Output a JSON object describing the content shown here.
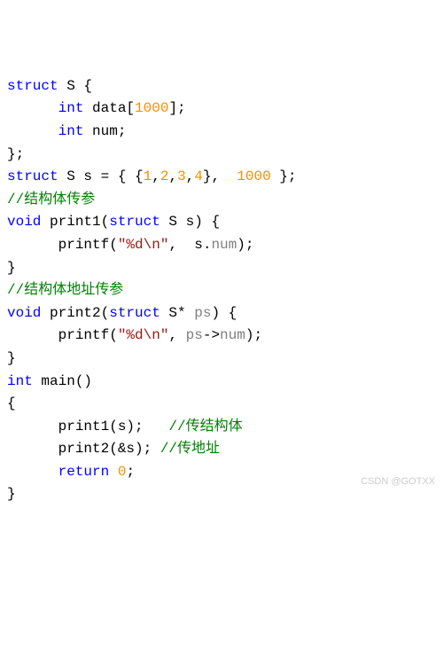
{
  "lines": [
    {
      "indent": 0,
      "parts": [
        {
          "c": "kw",
          "t": "struct"
        },
        {
          "t": " S {"
        }
      ]
    },
    {
      "indent": 1,
      "parts": [
        {
          "c": "kw",
          "t": "int"
        },
        {
          "t": " data["
        },
        {
          "c": "num",
          "t": "1000"
        },
        {
          "t": "];"
        }
      ]
    },
    {
      "indent": 1,
      "parts": [
        {
          "c": "kw",
          "t": "int"
        },
        {
          "t": " num;"
        }
      ]
    },
    {
      "indent": 0,
      "parts": [
        {
          "t": "};"
        }
      ]
    },
    {
      "indent": 0,
      "parts": [
        {
          "c": "kw",
          "t": "struct"
        },
        {
          "t": " S s = { {"
        },
        {
          "c": "num",
          "t": "1"
        },
        {
          "t": ","
        },
        {
          "c": "num",
          "t": "2"
        },
        {
          "t": ","
        },
        {
          "c": "num",
          "t": "3"
        },
        {
          "t": ","
        },
        {
          "c": "num",
          "t": "4"
        },
        {
          "t": "},  "
        },
        {
          "c": "num",
          "t": "1000"
        },
        {
          "t": " };"
        }
      ]
    },
    {
      "indent": 0,
      "parts": [
        {
          "c": "comment",
          "t": "//结构体传参"
        }
      ]
    },
    {
      "indent": 0,
      "parts": [
        {
          "c": "kw",
          "t": "void"
        },
        {
          "t": " print1("
        },
        {
          "c": "kw",
          "t": "struct"
        },
        {
          "t": " S s) {"
        }
      ]
    },
    {
      "indent": 1,
      "parts": [
        {
          "t": "printf("
        },
        {
          "c": "str",
          "t": "\"%d\\n\""
        },
        {
          "t": ",  s."
        },
        {
          "c": "member",
          "t": "num"
        },
        {
          "t": ");"
        }
      ]
    },
    {
      "indent": 0,
      "parts": [
        {
          "t": "}"
        }
      ]
    },
    {
      "indent": 0,
      "parts": [
        {
          "c": "comment",
          "t": "//结构体地址传参"
        }
      ]
    },
    {
      "indent": 0,
      "parts": [
        {
          "c": "kw",
          "t": "void"
        },
        {
          "t": " print2("
        },
        {
          "c": "kw",
          "t": "struct"
        },
        {
          "t": " S* "
        },
        {
          "c": "member",
          "t": "ps"
        },
        {
          "t": ") {"
        }
      ]
    },
    {
      "indent": 1,
      "parts": [
        {
          "t": "printf("
        },
        {
          "c": "str",
          "t": "\"%d\\n\""
        },
        {
          "t": ", "
        },
        {
          "c": "member",
          "t": "ps"
        },
        {
          "t": "->"
        },
        {
          "c": "member",
          "t": "num"
        },
        {
          "t": ");"
        }
      ]
    },
    {
      "indent": 0,
      "parts": [
        {
          "t": "}"
        }
      ]
    },
    {
      "indent": 0,
      "parts": [
        {
          "c": "kw",
          "t": "int"
        },
        {
          "t": " main()"
        }
      ]
    },
    {
      "indent": 0,
      "parts": [
        {
          "t": "{"
        }
      ]
    },
    {
      "indent": 1,
      "parts": [
        {
          "t": "print1(s);   "
        },
        {
          "c": "comment",
          "t": "//传结构体"
        }
      ]
    },
    {
      "indent": 1,
      "parts": [
        {
          "t": "print2(&s); "
        },
        {
          "c": "comment",
          "t": "//传地址"
        }
      ]
    },
    {
      "indent": 1,
      "parts": [
        {
          "c": "kw",
          "t": "return"
        },
        {
          "t": " "
        },
        {
          "c": "num",
          "t": "0"
        },
        {
          "t": ";"
        }
      ]
    },
    {
      "indent": 0,
      "parts": [
        {
          "t": "}"
        }
      ]
    }
  ],
  "indentUnit": "      ",
  "watermark": "CSDN @GOTXX"
}
